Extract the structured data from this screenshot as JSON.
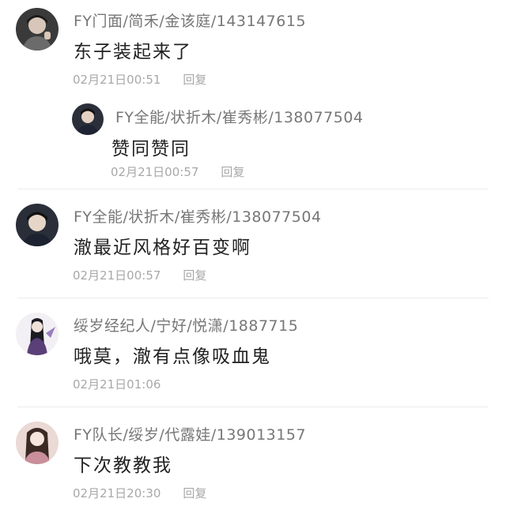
{
  "comments": [
    {
      "name": "FY门面/简禾/金该庭/143147615",
      "text": "东子装起来了",
      "time": "02月21日00:51",
      "reply_label": "回复"
    },
    {
      "name": "FY全能/状折木/崔秀彬/138077504",
      "text": "赞同赞同",
      "time": "02月21日00:57",
      "reply_label": "回复"
    },
    {
      "name": "FY全能/状折木/崔秀彬/138077504",
      "text": "澈最近风格好百变啊",
      "time": "02月21日00:57",
      "reply_label": "回复"
    },
    {
      "name": "绥岁经纪人/宁好/悦潇/1887715",
      "text": "哦莫，澈有点像吸血鬼",
      "time": "02月21日01:06",
      "reply_label": ""
    },
    {
      "name": "FY队长/绥岁/代露娃/139013157",
      "text": "下次教教我",
      "time": "02月21日20:30",
      "reply_label": "回复"
    }
  ]
}
